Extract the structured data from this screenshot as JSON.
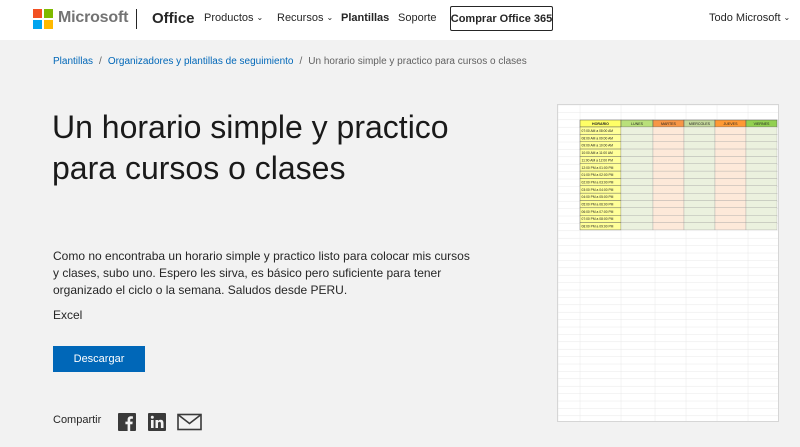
{
  "header": {
    "brand": "Microsoft",
    "product": "Office",
    "nav": [
      {
        "label": "Productos",
        "has_menu": true
      },
      {
        "label": "Recursos",
        "has_menu": true
      },
      {
        "label": "Plantillas",
        "has_menu": false
      },
      {
        "label": "Soporte",
        "has_menu": false
      }
    ],
    "buy_label": "Comprar Office 365",
    "all_microsoft": "Todo Microsoft",
    "logo_colors": [
      "#f25022",
      "#7fba00",
      "#00a4ef",
      "#ffb900"
    ]
  },
  "breadcrumb": [
    {
      "label": "Plantillas",
      "link": true
    },
    {
      "label": "Organizadores y plantillas de seguimiento",
      "link": true
    },
    {
      "label": "Un horario simple y practico para cursos o clases",
      "link": false
    }
  ],
  "template": {
    "title": "Un horario simple y practico para cursos o clases",
    "description": "Como no encontraba un horario simple y practico listo para colocar mis cursos y clases, subo uno. Espero les sirva, es básico pero suficiente para tener organizado el ciclo o la semana. Saludos desde PERU.",
    "app": "Excel",
    "download_label": "Descargar"
  },
  "share": {
    "label": "Compartir",
    "icons": [
      "facebook-icon",
      "linkedin-icon",
      "email-icon"
    ]
  },
  "preview": {
    "headers": [
      "HORARIO",
      "LUNES",
      "MARTES",
      "MIERCOLES",
      "JUEVES",
      "VIERNES"
    ],
    "header_colors": [
      "#ffff66",
      "#b9e07a",
      "#f79646",
      "#c4d79b",
      "#ff9933",
      "#92d050"
    ],
    "times": [
      "07:00 AM a 08:00 AM",
      "08:00 AM a 09:00 AM",
      "09:00 AM a 10:00 AM",
      "10:00 AM a 11:00 AM",
      "11:00 AM a 12:00 PM",
      "12:00 PM a 01:00 PM",
      "01:00 PM a 02:00 PM",
      "02:00 PM a 03:00 PM",
      "03:00 PM a 04:00 PM",
      "04:00 PM a 05:00 PM",
      "05:00 PM a 06:00 PM",
      "06:00 PM a 07:00 PM",
      "07:00 PM a 08:00 PM",
      "08:00 PM a 09:00 PM"
    ],
    "time_fill": "#ffff99",
    "cell_fills": [
      "#ebf1de",
      "#fde9d9",
      "#ebf1de",
      "#fde9d9",
      "#ebf1de"
    ]
  }
}
